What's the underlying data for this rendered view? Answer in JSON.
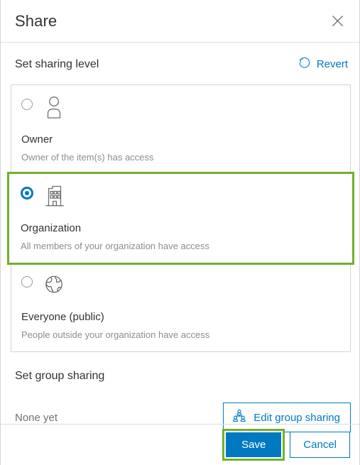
{
  "dialog": {
    "title": "Share",
    "close_icon": "close-icon"
  },
  "sharing_level": {
    "heading": "Set sharing level",
    "revert_label": "Revert",
    "revert_icon": "revert-circular-arrow-icon",
    "options": [
      {
        "id": "owner",
        "label": "Owner",
        "description": "Owner of the item(s) has access",
        "icon": "person-icon",
        "selected": false,
        "highlighted": false
      },
      {
        "id": "organization",
        "label": "Organization",
        "description": "All members of your organization have access",
        "icon": "building-icon",
        "selected": true,
        "highlighted": true
      },
      {
        "id": "everyone",
        "label": "Everyone (public)",
        "description": "People outside your organization have access",
        "icon": "globe-icon",
        "selected": false,
        "highlighted": false
      }
    ]
  },
  "group_sharing": {
    "heading": "Set group sharing",
    "status": "None yet",
    "edit_button_label": "Edit group sharing",
    "edit_button_icon": "group-people-icon"
  },
  "footer": {
    "save_label": "Save",
    "cancel_label": "Cancel",
    "save_highlighted": true
  },
  "colors": {
    "accent_blue": "#0079c1",
    "highlight_green": "#6fb22c",
    "text_primary": "#323232",
    "text_muted": "#8d8d8d",
    "border": "#d4d4d4"
  }
}
